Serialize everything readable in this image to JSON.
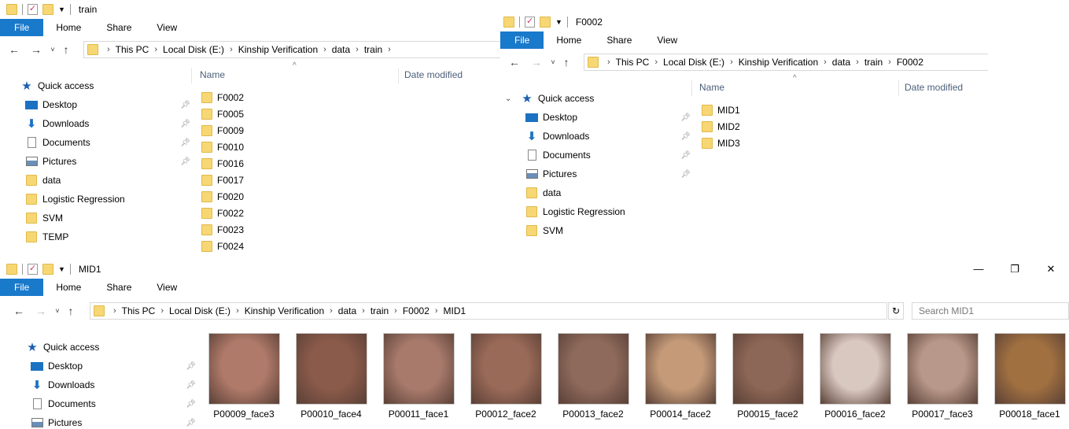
{
  "win1": {
    "title": "train",
    "tabs": [
      "File",
      "Home",
      "Share",
      "View"
    ],
    "breadcrumb": [
      "This PC",
      "Local Disk (E:)",
      "Kinship Verification",
      "data",
      "train"
    ],
    "sidebar": [
      {
        "label": "Quick access",
        "icon": "star-icon",
        "pinned": false
      },
      {
        "label": "Desktop",
        "icon": "desktop-icon",
        "pinned": true
      },
      {
        "label": "Downloads",
        "icon": "download-icon",
        "pinned": true
      },
      {
        "label": "Documents",
        "icon": "documents-icon",
        "pinned": true
      },
      {
        "label": "Pictures",
        "icon": "pictures-icon",
        "pinned": true
      },
      {
        "label": "data",
        "icon": "folder-icon",
        "pinned": false
      },
      {
        "label": "Logistic Regression",
        "icon": "folder-icon",
        "pinned": false
      },
      {
        "label": "SVM",
        "icon": "folder-icon",
        "pinned": false
      },
      {
        "label": "TEMP",
        "icon": "folder-icon",
        "pinned": false
      }
    ],
    "columns": [
      "Name",
      "Date modified"
    ],
    "files": [
      "F0002",
      "F0005",
      "F0009",
      "F0010",
      "F0016",
      "F0017",
      "F0020",
      "F0022",
      "F0023",
      "F0024"
    ]
  },
  "win2": {
    "title": "F0002",
    "tabs": [
      "File",
      "Home",
      "Share",
      "View"
    ],
    "breadcrumb": [
      "This PC",
      "Local Disk (E:)",
      "Kinship Verification",
      "data",
      "train",
      "F0002"
    ],
    "sidebar": [
      {
        "label": "Quick access",
        "icon": "star-icon",
        "pinned": false
      },
      {
        "label": "Desktop",
        "icon": "desktop-icon",
        "pinned": true
      },
      {
        "label": "Downloads",
        "icon": "download-icon",
        "pinned": true
      },
      {
        "label": "Documents",
        "icon": "documents-icon",
        "pinned": true
      },
      {
        "label": "Pictures",
        "icon": "pictures-icon",
        "pinned": true
      },
      {
        "label": "data",
        "icon": "folder-icon",
        "pinned": false
      },
      {
        "label": "Logistic Regression",
        "icon": "folder-icon",
        "pinned": false
      },
      {
        "label": "SVM",
        "icon": "folder-icon",
        "pinned": false
      }
    ],
    "columns": [
      "Name",
      "Date modified"
    ],
    "files": [
      "MID1",
      "MID2",
      "MID3"
    ]
  },
  "win3": {
    "title": "MID1",
    "tabs": [
      "File",
      "Home",
      "Share",
      "View"
    ],
    "breadcrumb": [
      "This PC",
      "Local Disk (E:)",
      "Kinship Verification",
      "data",
      "train",
      "F0002",
      "MID1"
    ],
    "search_placeholder": "Search MID1",
    "sidebar": [
      {
        "label": "Quick access",
        "icon": "star-icon",
        "pinned": false
      },
      {
        "label": "Desktop",
        "icon": "desktop-icon",
        "pinned": true
      },
      {
        "label": "Downloads",
        "icon": "download-icon",
        "pinned": true
      },
      {
        "label": "Documents",
        "icon": "documents-icon",
        "pinned": true
      },
      {
        "label": "Pictures",
        "icon": "pictures-icon",
        "pinned": true
      }
    ],
    "thumbnails": [
      {
        "name": "P00009_face3",
        "color": "#b07a6a"
      },
      {
        "name": "P00010_face4",
        "color": "#8a5a4a"
      },
      {
        "name": "P00011_face1",
        "color": "#a87a6c"
      },
      {
        "name": "P00012_face2",
        "color": "#9a6a58"
      },
      {
        "name": "P00013_face2",
        "color": "#8e6a5c"
      },
      {
        "name": "P00014_face2",
        "color": "#c49a78"
      },
      {
        "name": "P00015_face2",
        "color": "#8c6656"
      },
      {
        "name": "P00016_face2",
        "color": "#d9c8c0"
      },
      {
        "name": "P00017_face3",
        "color": "#b8988a"
      },
      {
        "name": "P00018_face1",
        "color": "#a07040"
      }
    ]
  },
  "accent": "#1979ca"
}
